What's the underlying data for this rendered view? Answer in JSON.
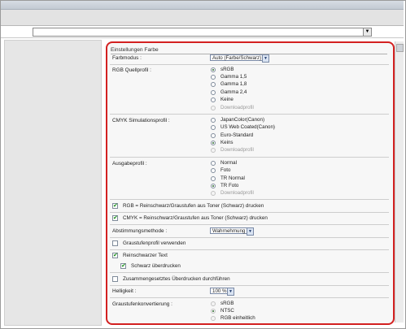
{
  "panel": {
    "title": "Einstellungen Farbe"
  },
  "farbmodus": {
    "label": "Farbmodus :",
    "value": "Auto (Farbe/Schwarz)",
    "arrow": "▼"
  },
  "rgb_quellprofil": {
    "label": "RGB Quellprofil :",
    "options": [
      {
        "label": "sRGB",
        "selected": true,
        "disabled": false
      },
      {
        "label": "Gamma 1,5",
        "selected": false,
        "disabled": false
      },
      {
        "label": "Gamma 1,8",
        "selected": false,
        "disabled": false
      },
      {
        "label": "Gamma 2,4",
        "selected": false,
        "disabled": false
      },
      {
        "label": "Keine",
        "selected": false,
        "disabled": false
      },
      {
        "label": "Downloadprofil",
        "selected": false,
        "disabled": true
      }
    ]
  },
  "cmyk_simulationsprofil": {
    "label": "CMYK Simulationsprofil :",
    "options": [
      {
        "label": "JapanColor(Canon)",
        "selected": false,
        "disabled": false
      },
      {
        "label": "US Web Coated(Canon)",
        "selected": false,
        "disabled": false
      },
      {
        "label": "Euro-Standard",
        "selected": false,
        "disabled": false
      },
      {
        "label": "Keins",
        "selected": true,
        "disabled": false
      },
      {
        "label": "Downloadprofil",
        "selected": false,
        "disabled": true
      }
    ]
  },
  "ausgabeprofil": {
    "label": "Ausgabeprofil :",
    "options": [
      {
        "label": "Normal",
        "selected": false,
        "disabled": false
      },
      {
        "label": "Foto",
        "selected": false,
        "disabled": false
      },
      {
        "label": "TR Normal",
        "selected": false,
        "disabled": false
      },
      {
        "label": "TR Foto",
        "selected": true,
        "disabled": false
      },
      {
        "label": "Downloadprofil",
        "selected": false,
        "disabled": true
      }
    ]
  },
  "checkboxes": {
    "rgb_rein": {
      "label": "RGB = Reinschwarz/Graustufen aus Toner (Schwarz) drucken",
      "checked": true
    },
    "cmyk_rein": {
      "label": "CMYK = Reinschwarz/Graustufen aus Toner (Schwarz) drucken",
      "checked": true
    },
    "graustufenprofil": {
      "label": "Graustufenprofil verwenden",
      "checked": false
    },
    "reinschwarzer_text": {
      "label": "Reinschwarzer Text",
      "checked": true
    },
    "schwarz_ueberdrucken": {
      "label": "Schwarz überdrucken",
      "checked": true
    },
    "zusammengesetzt": {
      "label": "Zusammengesetztes Überdrucken durchführen",
      "checked": false
    }
  },
  "abstimmungsmethode": {
    "label": "Abstimmungsmethode :",
    "value": "Wahrnehmung",
    "arrow": "▼"
  },
  "helligkeit": {
    "label": "Helligkeit :",
    "value": "100 %",
    "arrow": "▼"
  },
  "graustufenkonvertierung": {
    "label": "Graustufenkonvertierung :",
    "options": [
      {
        "label": "sRGB",
        "selected": false,
        "disabled": true
      },
      {
        "label": "NTSC",
        "selected": true,
        "disabled": true
      },
      {
        "label": "RGB einheitlich",
        "selected": false,
        "disabled": true
      }
    ]
  },
  "check_mark": "✔",
  "address_arrow": "▼"
}
